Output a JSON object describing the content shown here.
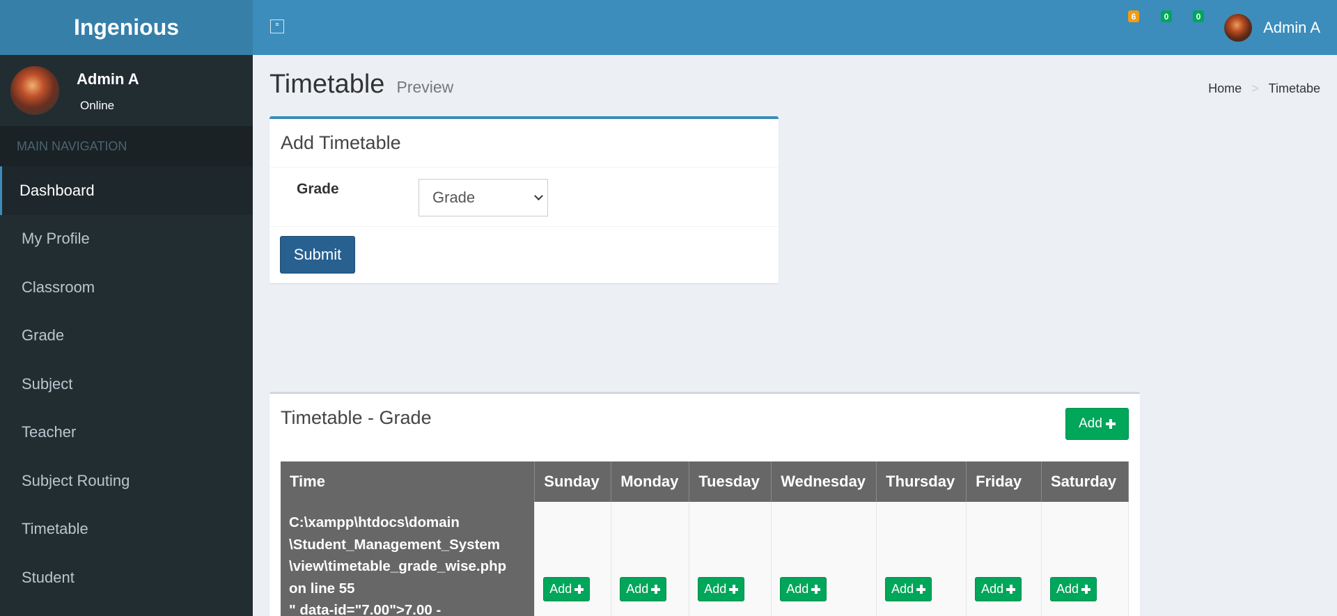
{
  "app": {
    "logo": "Ingenious"
  },
  "header": {
    "badges": [
      "6",
      "0",
      "0"
    ],
    "user_name": "Admin A",
    "toggle_label": "≡"
  },
  "sidebar": {
    "user_name": "Admin A",
    "user_status": "Online",
    "nav_header": "MAIN NAVIGATION",
    "items": [
      {
        "label": "Dashboard",
        "active": true
      },
      {
        "label": "My Profile"
      },
      {
        "label": "Classroom"
      },
      {
        "label": "Grade"
      },
      {
        "label": "Subject"
      },
      {
        "label": "Teacher"
      },
      {
        "label": "Subject Routing"
      },
      {
        "label": "Timetable"
      },
      {
        "label": "Student"
      }
    ]
  },
  "page": {
    "title": "Timetable",
    "subtitle": "Preview",
    "breadcrumb": [
      "Home",
      "Timetabe"
    ],
    "breadcrumb_sep": ">"
  },
  "add_form": {
    "title": "Add Timetable",
    "grade_label": "Grade",
    "grade_selected": "Grade",
    "submit_label": "Submit"
  },
  "timetable": {
    "title": "Timetable - Grade",
    "add_label": "Add",
    "columns": [
      "Time",
      "Sunday",
      "Monday",
      "Tuesday",
      "Wednesday",
      "Thursday",
      "Friday",
      "Saturday"
    ],
    "rows": [
      {
        "time": "C:\\xampp\\htdocs\\domain\n\\Student_Management_System\n\\view\\timetable_grade_wise.php\non line 55\n\" data-id=\"7.00\">7.00 -",
        "cell_label": "Add"
      }
    ]
  },
  "colors": {
    "header_bg": "#3c8dbc",
    "logo_bg": "#367fa9",
    "sidebar_bg": "#222d32",
    "success": "#00a65a",
    "primary": "#286090",
    "warning": "#f39c12"
  }
}
